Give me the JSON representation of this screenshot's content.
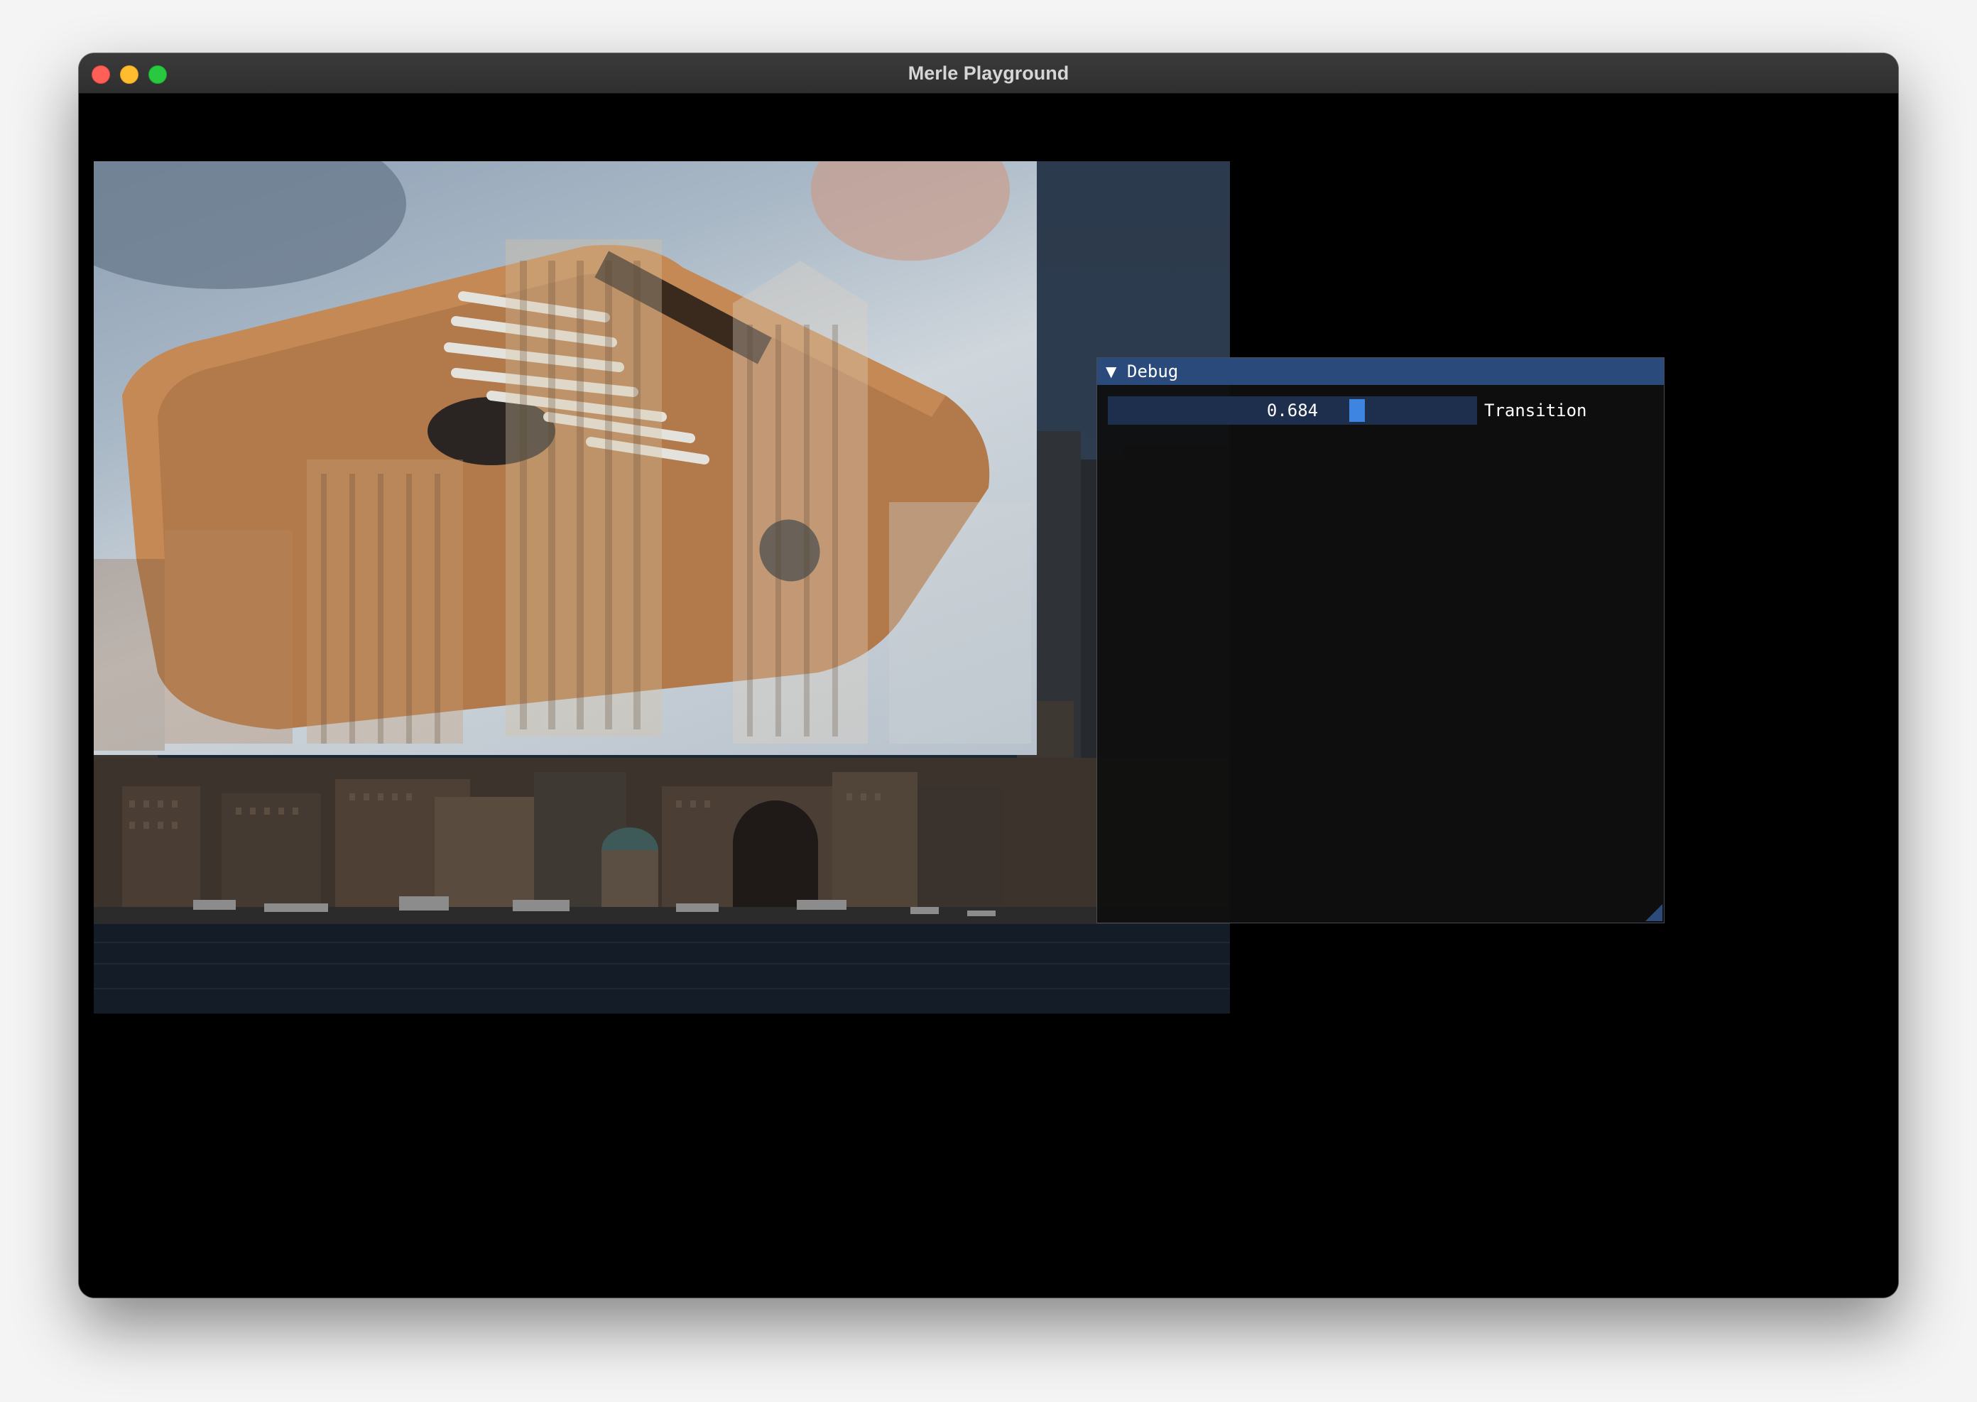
{
  "window": {
    "title": "Merle Playground"
  },
  "debug_panel": {
    "title": "Debug",
    "collapse_icon": "triangle-down-icon",
    "slider": {
      "label": "Transition",
      "value": 0.684,
      "value_text": "0.684",
      "min": 0,
      "max": 1
    }
  },
  "colors": {
    "imgui_title_bg": "#294a7a",
    "imgui_slider_bg": "#1d2f4d",
    "imgui_slider_grab": "#3d85e0",
    "close_button": "#fe5f57",
    "minimize_button": "#febc2e",
    "maximize_button": "#28c840"
  }
}
